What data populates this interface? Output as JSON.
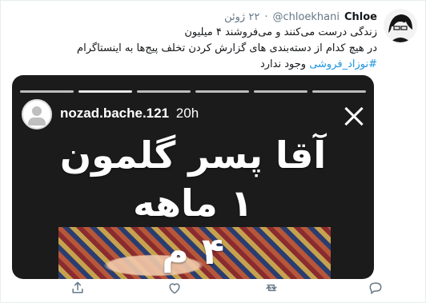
{
  "tweet": {
    "author_name": "Chloe",
    "author_handle": "@chloekhani",
    "separator": "·",
    "time": "۲۲ ژوئن",
    "text_line1": "زندگی درست می‌کنند و می‌فروشند ۴ میلیون",
    "text_line2": "در هیچ کدام از دسته‌بندی های گزارش کردن تخلف پیج‌ها به اینستاگرام",
    "hashtag": "#نوزاد_فروشی",
    "text_line3_tail": " وجود ندارد"
  },
  "story": {
    "username": "nozad.bache.121",
    "ago": "20h",
    "overlay_lines": [
      "آقا پسر گلمون",
      "۱ ماهه",
      "۴ م"
    ]
  },
  "colors": {
    "link": "#1b95e0",
    "muted": "#657786",
    "text": "#14171a"
  },
  "icons": [
    "reply-icon",
    "retweet-icon",
    "like-icon",
    "share-icon",
    "close-icon",
    "avatar-placeholder-icon"
  ]
}
